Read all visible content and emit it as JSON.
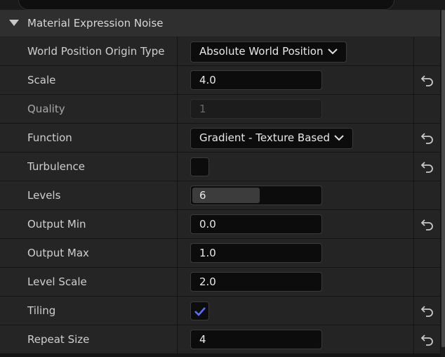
{
  "section": {
    "title": "Material Expression Noise"
  },
  "properties": [
    {
      "name": "World Position Origin Type",
      "type": "dropdown",
      "value": "Absolute World Position",
      "reset": false
    },
    {
      "name": "Scale",
      "type": "number",
      "value": "4.0",
      "reset": true
    },
    {
      "name": "Quality",
      "type": "number",
      "value": "1",
      "disabled": true,
      "reset": false
    },
    {
      "name": "Function",
      "type": "dropdown",
      "value": "Gradient - Texture Based",
      "reset": true
    },
    {
      "name": "Turbulence",
      "type": "checkbox",
      "checked": false,
      "reset": true
    },
    {
      "name": "Levels",
      "type": "slider",
      "value": "6",
      "fill_fraction": 0.52,
      "reset": false
    },
    {
      "name": "Output Min",
      "type": "number",
      "value": "0.0",
      "reset": true
    },
    {
      "name": "Output Max",
      "type": "number",
      "value": "1.0",
      "reset": false
    },
    {
      "name": "Level Scale",
      "type": "number",
      "value": "2.0",
      "reset": false
    },
    {
      "name": "Tiling",
      "type": "checkbox",
      "checked": true,
      "reset": true
    },
    {
      "name": "Repeat Size",
      "type": "number",
      "value": "4",
      "reset": true
    }
  ],
  "colors": {
    "accent_check": "#5b6ef5"
  },
  "icons": {
    "header": "triangle-down-icon",
    "dropdown": "chevron-down-icon",
    "reset": "reset-arrow-icon",
    "check": "checkmark-icon"
  }
}
